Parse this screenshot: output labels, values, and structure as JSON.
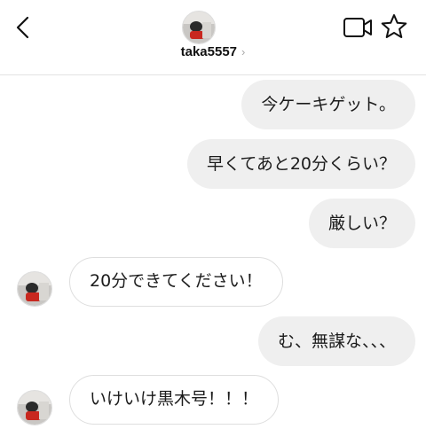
{
  "header": {
    "username": "taka5557",
    "chevron": "›",
    "icons": {
      "back": "back-chevron-icon",
      "video": "video-call-icon",
      "star": "star-icon"
    }
  },
  "messages": [
    {
      "side": "outgoing",
      "text": "今ケーキゲット。"
    },
    {
      "side": "outgoing",
      "text": "早くてあと20分くらい？"
    },
    {
      "side": "outgoing",
      "text": "厳しい？"
    },
    {
      "side": "incoming",
      "text": "20分できてください！"
    },
    {
      "side": "outgoing",
      "text": "む、無謀な、、、"
    },
    {
      "side": "incoming",
      "text": "いけいけ黒木号！！！"
    }
  ],
  "colors": {
    "outgoing_bubble": "#efefef",
    "incoming_border": "#dedede",
    "header_border": "#e3e3e3"
  }
}
